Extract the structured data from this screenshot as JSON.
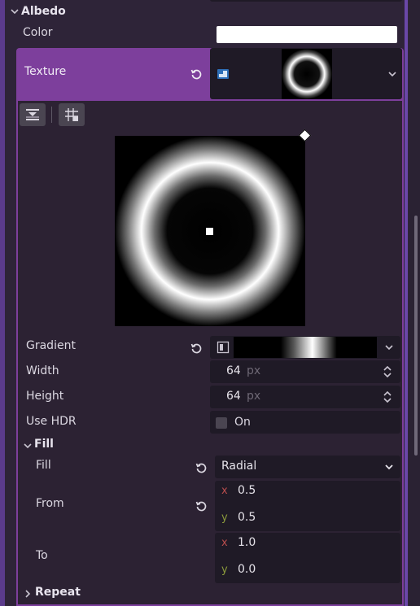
{
  "albedo": {
    "section_label": "Albedo",
    "color_label": "Color",
    "color_value": "#ffffff",
    "texture_label": "Texture"
  },
  "gradient_texture": {
    "gradient_label": "Gradient",
    "width_label": "Width",
    "width_value": "64",
    "width_unit": "px",
    "height_label": "Height",
    "height_value": "64",
    "height_unit": "px",
    "use_hdr_label": "Use HDR",
    "use_hdr_value": "On",
    "use_hdr_checked": false
  },
  "fill_section": {
    "section_label": "Fill",
    "fill_label": "Fill",
    "fill_value": "Radial",
    "from_label": "From",
    "from_x": "0.5",
    "from_y": "0.5",
    "to_label": "To",
    "to_x": "1.0",
    "to_y": "0.0",
    "axis_x": "x",
    "axis_y": "y"
  },
  "repeat_section": {
    "section_label": "Repeat"
  },
  "colors": {
    "accent_purple": "#7d3f9c",
    "field_bg": "#1f1a26",
    "panel_bg": "#2e2438"
  }
}
